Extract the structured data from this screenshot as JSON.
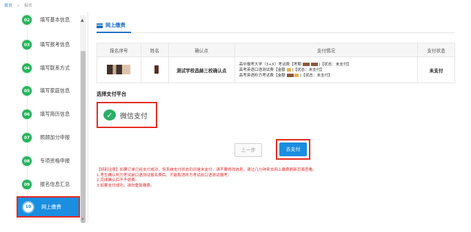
{
  "breadcrumb": {
    "home": "首页",
    "current": "报名"
  },
  "sidebar": {
    "steps": [
      {
        "num": "02",
        "label": "填写基本信息"
      },
      {
        "num": "03",
        "label": "填写报考信息"
      },
      {
        "num": "04",
        "label": "填写联系方式"
      },
      {
        "num": "05",
        "label": "填写家庭信息"
      },
      {
        "num": "06",
        "label": "填写简历信息"
      },
      {
        "num": "07",
        "label": "照顾加分申报"
      },
      {
        "num": "08",
        "label": "专项资格申报"
      },
      {
        "num": "09",
        "label": "报名信息汇总"
      },
      {
        "num": "10",
        "label": "网上缴费"
      }
    ]
  },
  "main": {
    "tab_label": "网上缴费",
    "table": {
      "headers": [
        "报名序号",
        "姓名",
        "确认点",
        "支付情况",
        "支付状态"
      ],
      "row": {
        "confirm_point": "测试学校昌赫三校确认点",
        "detail_lines": [
          "高中报考大学（3+X）考试费【考期",
          "|【状态：未支付】",
          "高考英语口语测试费【金额",
          "|【状态：未支付】",
          "高考英语听力考试费【金额",
          "|【状态：未支付】"
        ],
        "status": "未支付"
      }
    },
    "platform_title": "选择支付平台",
    "wechat_label": "微信支付",
    "prev_button": "上一步",
    "pay_button": "去支付",
    "notice_lines": [
      "【特别注意】如果订单已经支付成功，但系统支付状态仍旧是未支付，请不要修改信息，请过几分钟来去网上缴费刷新页面查看。",
      "1.考生确认听力考试前口语测试报名费后，不能取消听力考试前口语测试报考。",
      "2.完成确认后不予退费。",
      "3.如果支付成功，请勿重复缴费。"
    ]
  },
  "colors": {
    "accent": "#1a8ee0",
    "step_green": "#27b35d",
    "highlight_red": "#e5271c",
    "wechat_green": "#2aae67"
  }
}
